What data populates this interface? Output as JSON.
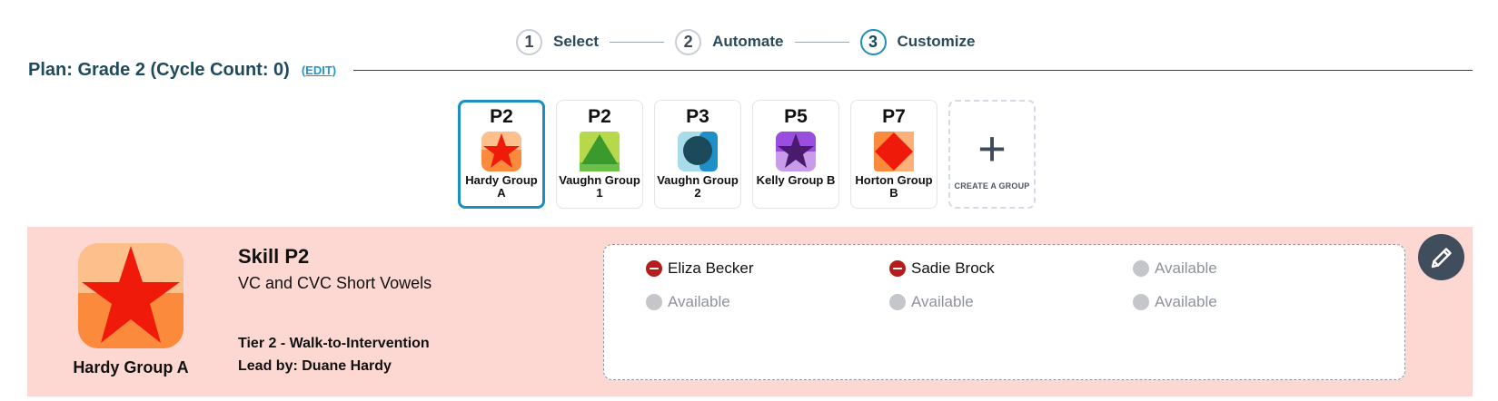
{
  "stepper": {
    "steps": [
      {
        "number": "1",
        "label": "Select"
      },
      {
        "number": "2",
        "label": "Automate"
      },
      {
        "number": "3",
        "label": "Customize"
      }
    ],
    "active_step": 3
  },
  "plan": {
    "title": "Plan: Grade 2 (Cycle Count: 0)",
    "edit_label": "(EDIT)"
  },
  "groups": [
    {
      "code": "P2",
      "name": "Hardy Group A",
      "icon": "red-star-icon",
      "selected": true
    },
    {
      "code": "P2",
      "name": "Vaughn Group 1",
      "icon": "green-triangle-icon",
      "selected": false
    },
    {
      "code": "P3",
      "name": "Vaughn Group 2",
      "icon": "teal-circle-icon",
      "selected": false
    },
    {
      "code": "P5",
      "name": "Kelly Group B",
      "icon": "purple-star-icon",
      "selected": false
    },
    {
      "code": "P7",
      "name": "Horton Group B",
      "icon": "red-diamond-icon",
      "selected": false
    }
  ],
  "create_group_label": "CREATE A GROUP",
  "detail": {
    "group_name": "Hardy Group A",
    "skill_title": "Skill P2",
    "skill_subtitle": "VC and CVC Short Vowels",
    "tier": "Tier 2 - Walk-to-Intervention",
    "lead": "Lead by: Duane Hardy",
    "slots": [
      {
        "label": "Eliza Becker",
        "status": "taken"
      },
      {
        "label": "Sadie Brock",
        "status": "taken"
      },
      {
        "label": "Available",
        "status": "open"
      },
      {
        "label": "Available",
        "status": "open"
      },
      {
        "label": "Available",
        "status": "open"
      },
      {
        "label": "Available",
        "status": "open"
      }
    ]
  },
  "colors": {
    "accent": "#1a8fc4",
    "panel_bg": "#fdd8d3",
    "taken": "#b51c1c",
    "open": "#c4c6c9"
  }
}
